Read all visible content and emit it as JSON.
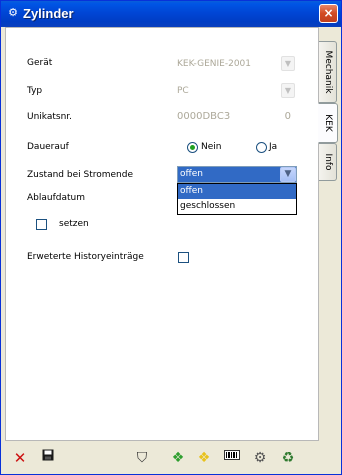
{
  "window": {
    "title": "Zylinder",
    "title_icon": "wrench-gear-icon",
    "close_label": "×"
  },
  "tabs": [
    {
      "label": "Mechanik",
      "active": false
    },
    {
      "label": "KEK",
      "active": true
    },
    {
      "label": "Info",
      "active": false
    }
  ],
  "form": {
    "geraet": {
      "label": "Gerät",
      "value": "KEK-GENIE-2001"
    },
    "typ": {
      "label": "Typ",
      "value": "PC"
    },
    "unikat": {
      "label": "Unikatsnr.",
      "value": "0000DBC3",
      "extra": "0"
    },
    "dauerauf": {
      "label": "Dauerauf",
      "options": [
        "Nein",
        "Ja"
      ],
      "selected": "Nein"
    },
    "zustand": {
      "label": "Zustand bei Stromende",
      "value": "offen",
      "dropdown_options": [
        "offen",
        "geschlossen"
      ],
      "highlighted": "offen"
    },
    "ablauf": {
      "label": "Ablaufdatum",
      "checkbox_label": "setzen",
      "checked": false
    },
    "history": {
      "label": "Erweterte Historyeinträge",
      "checked": false
    }
  },
  "toolbar": {
    "icons": [
      "delete-icon",
      "save-icon",
      "cart-icon",
      "program-icon",
      "program-alt-icon",
      "barcode-icon",
      "key-gear-icon",
      "trash-icon"
    ],
    "colors": {
      "delete": "#cc1111",
      "save": "#1a1a1a",
      "green": "#2f9e2f",
      "yellow": "#e8c21c"
    }
  }
}
